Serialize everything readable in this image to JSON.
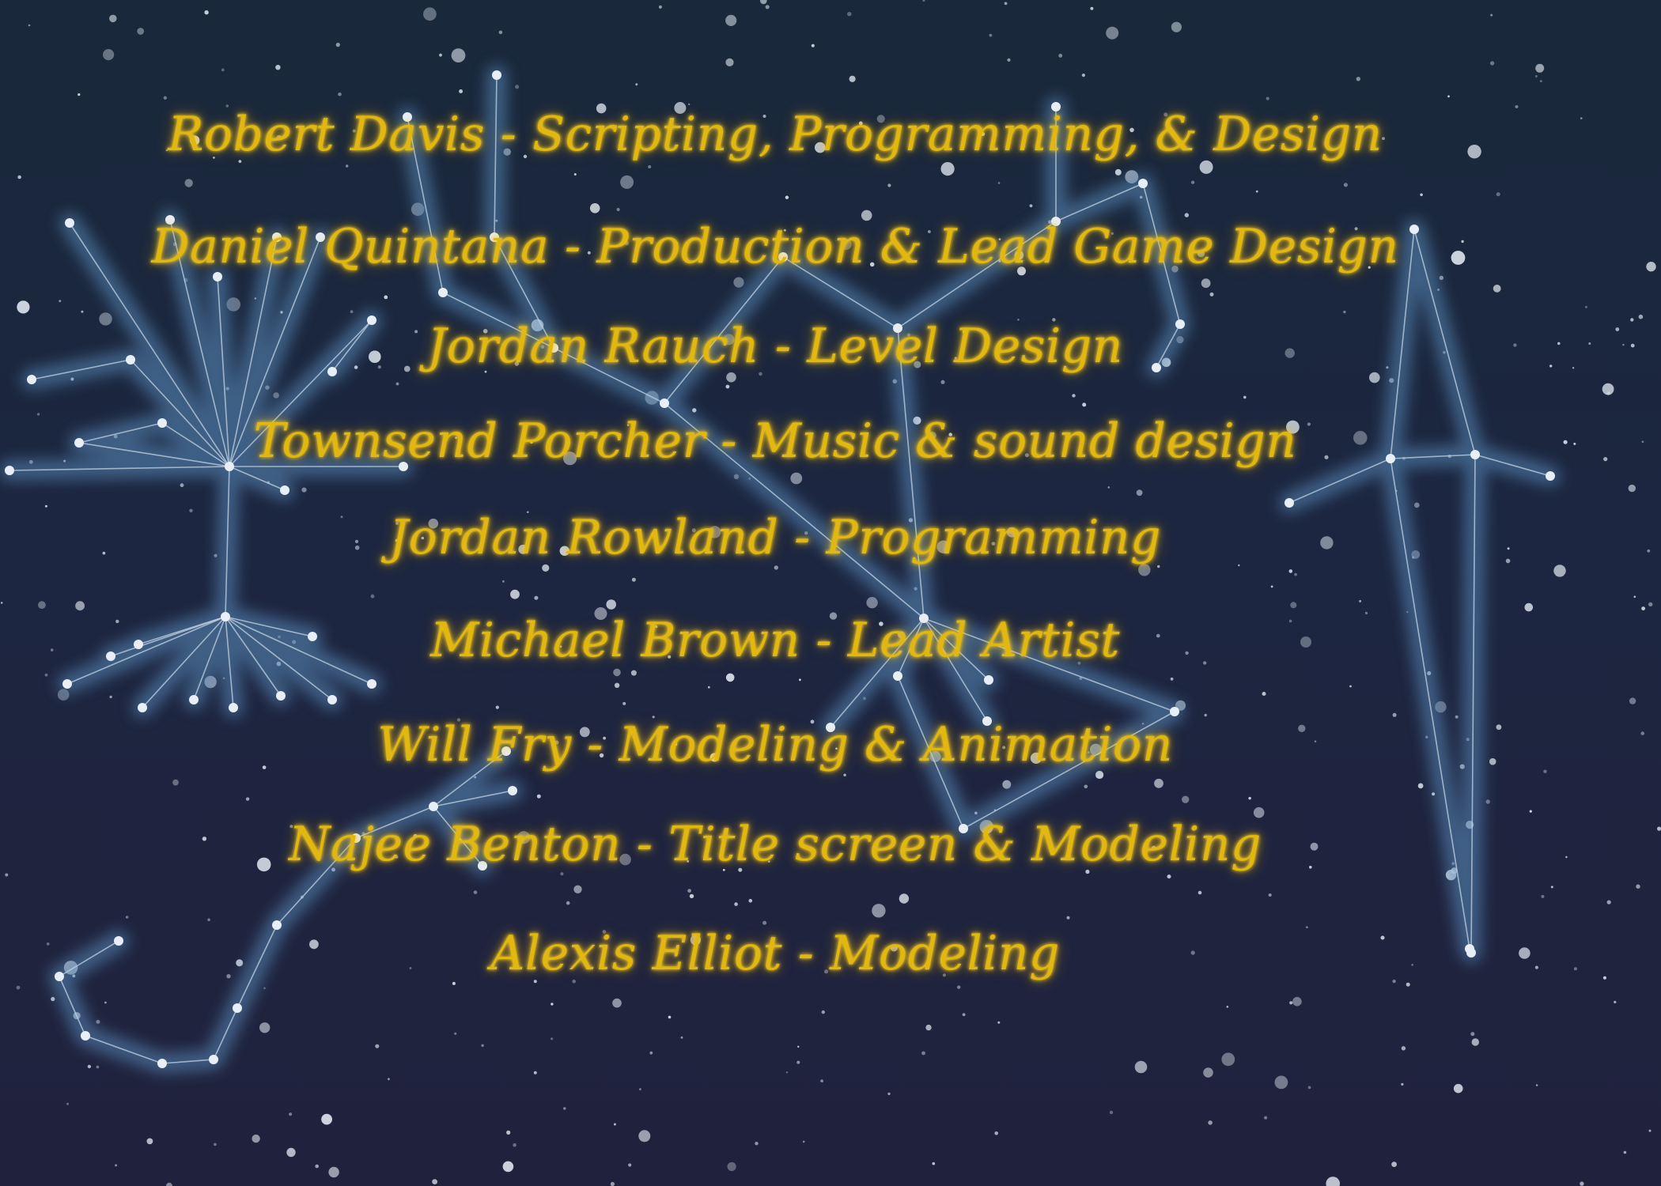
{
  "credits": [
    {
      "name": "Robert Davis",
      "role": "Scripting, Programming, & Design",
      "text": "Robert Davis - Scripting, Programming, & Design"
    },
    {
      "name": "Daniel Quintana",
      "role": "Production & Lead Game Design",
      "text": "Daniel Quintana - Production & Lead Game Design"
    },
    {
      "name": "Jordan Rauch",
      "role": "Level Design",
      "text": "Jordan Rauch - Level Design"
    },
    {
      "name": "Townsend Porcher",
      "role": "Music & sound design",
      "text": "Townsend Porcher - Music & sound design"
    },
    {
      "name": "Jordan Rowland",
      "role": "Programming",
      "text": "Jordan Rowland - Programming"
    },
    {
      "name": "Michael Brown",
      "role": "Lead Artist",
      "text": "Michael Brown - Lead Artist"
    },
    {
      "name": "Will Fry",
      "role": "Modeling & Animation",
      "text": "Will Fry - Modeling & Animation"
    },
    {
      "name": "Najee Benton",
      "role": "Title screen & Modeling",
      "text": "Najee Benton - Title screen & Modeling"
    },
    {
      "name": "Alexis Elliot",
      "role": "Modeling",
      "text": "Alexis Elliot - Modeling"
    }
  ],
  "colors": {
    "text": "#e2b70f",
    "glow": "#ffd21e",
    "sky_top": "#19283a",
    "sky_bottom": "#20223d",
    "constellation_glow": "#5b8fbf",
    "constellation_line": "#c4d3e2",
    "star": "#dfe6ef"
  }
}
